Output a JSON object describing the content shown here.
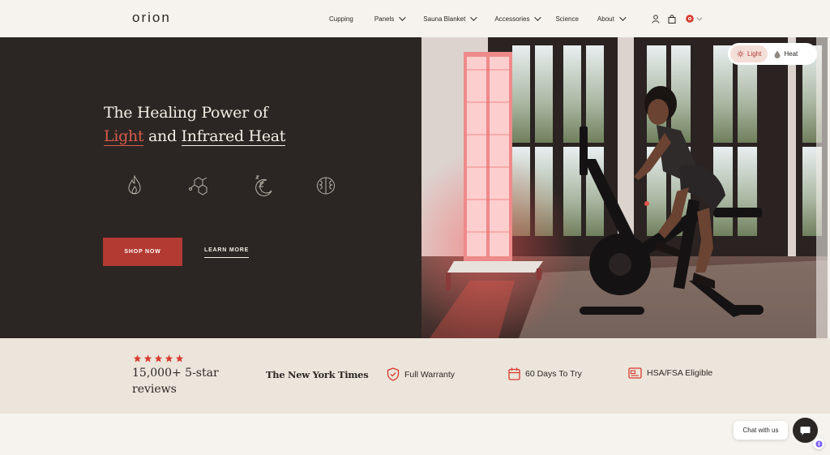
{
  "brand": {
    "logo": "orion"
  },
  "nav": {
    "items": [
      {
        "label": "Cupping",
        "dropdown": false
      },
      {
        "label": "Panels",
        "dropdown": true
      },
      {
        "label": "Sauna Blanket",
        "dropdown": true
      },
      {
        "label": "Accessories",
        "dropdown": true
      },
      {
        "label": "Science",
        "dropdown": false
      },
      {
        "label": "About",
        "dropdown": true
      }
    ],
    "utilities": [
      "account-icon",
      "cart-icon",
      "flag-icon"
    ]
  },
  "hero": {
    "headline_line1": "The Healing Power of",
    "headline_word_light": "Light",
    "headline_connector": " and ",
    "headline_word_heat": "Infrared Heat",
    "benefit_icons": [
      "flame-icon",
      "molecule-icon",
      "sleep-icon",
      "brain-icon"
    ],
    "cta_primary": "SHOP NOW",
    "cta_secondary": "LEARN MORE",
    "toggle": {
      "option_light": "Light",
      "option_heat": "Heat",
      "active": "Light"
    }
  },
  "trust": {
    "stars": 5,
    "reviews_text": "15,000+ 5-star reviews",
    "press": "The New York Times",
    "badges": [
      {
        "icon": "shield-check-icon",
        "label": "Full Warranty"
      },
      {
        "icon": "calendar-icon",
        "label": "60 Days To Try"
      },
      {
        "icon": "card-icon",
        "label": "HSA/FSA Eligible"
      }
    ]
  },
  "chat": {
    "label": "Chat with us"
  },
  "colors": {
    "accent": "#b23a32",
    "dark": "#2b2624",
    "cream": "#f6f3ee",
    "sand": "#ece5db",
    "star": "#d8392f"
  }
}
